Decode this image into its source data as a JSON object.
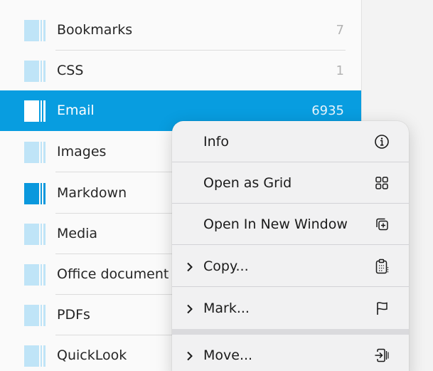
{
  "sidebar": {
    "items": [
      {
        "label": "Bookmarks",
        "count": "7",
        "icon": "folder-icon"
      },
      {
        "label": "CSS",
        "count": "1",
        "icon": "folder-icon"
      },
      {
        "label": "Email",
        "count": "6935",
        "icon": "folder-icon",
        "selected": true
      },
      {
        "label": "Images",
        "count": "",
        "icon": "folder-icon"
      },
      {
        "label": "Markdown",
        "count": "",
        "icon": "folder-icon"
      },
      {
        "label": "Media",
        "count": "",
        "icon": "folder-icon"
      },
      {
        "label": "Office document",
        "count": "",
        "icon": "folder-icon"
      },
      {
        "label": "PDFs",
        "count": "",
        "icon": "folder-icon"
      },
      {
        "label": "QuickLook",
        "count": "",
        "icon": "folder-icon"
      }
    ]
  },
  "context_menu": {
    "items": [
      {
        "label": "Info",
        "icon": "info-icon",
        "submenu": false
      },
      {
        "label": "Open as Grid",
        "icon": "grid-icon",
        "submenu": false
      },
      {
        "label": "Open In New Window",
        "icon": "new-window-icon",
        "submenu": false
      },
      {
        "label": "Copy...",
        "icon": "clipboard-icon",
        "submenu": true
      },
      {
        "label": "Mark...",
        "icon": "flag-icon",
        "submenu": true
      },
      {
        "label": "Move...",
        "icon": "move-icon",
        "submenu": true
      }
    ]
  },
  "colors": {
    "selection": "#089de0",
    "folder_light": "#bfe4f7",
    "folder_dark": "#0a98dd",
    "menu_background": "#f1f1f2"
  }
}
